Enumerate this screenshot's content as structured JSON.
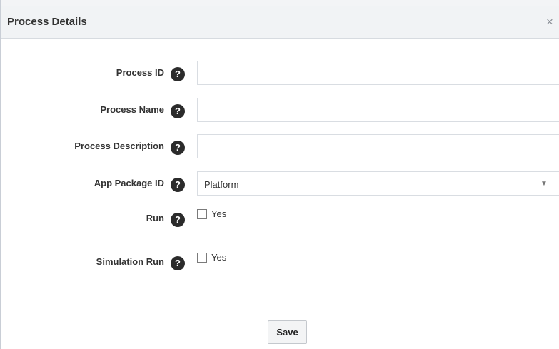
{
  "dialog": {
    "title": "Process Details",
    "close_glyph": "×",
    "save_label": "Save"
  },
  "fields": {
    "process_id": {
      "label": "Process ID",
      "value": "",
      "help": "?"
    },
    "process_name": {
      "label": "Process Name",
      "value": "",
      "help": "?"
    },
    "process_description": {
      "label": "Process Description",
      "value": "",
      "help": "?"
    },
    "app_package_id": {
      "label": "App Package ID",
      "selected": "Platform",
      "help": "?",
      "arrow": "▼"
    },
    "run": {
      "label": "Run",
      "option": "Yes",
      "checked": false,
      "help": "?"
    },
    "simulation_run": {
      "label": "Simulation Run",
      "option": "Yes",
      "checked": false,
      "help": "?"
    }
  },
  "colors": {
    "titlebar_bg": "#f1f3f5",
    "help_icon_bg": "#2b2b2b",
    "field_border": "#d9dde2"
  },
  "icons": {
    "close": "close-icon",
    "help": "help-icon",
    "dropdown": "chevron-down-icon"
  }
}
